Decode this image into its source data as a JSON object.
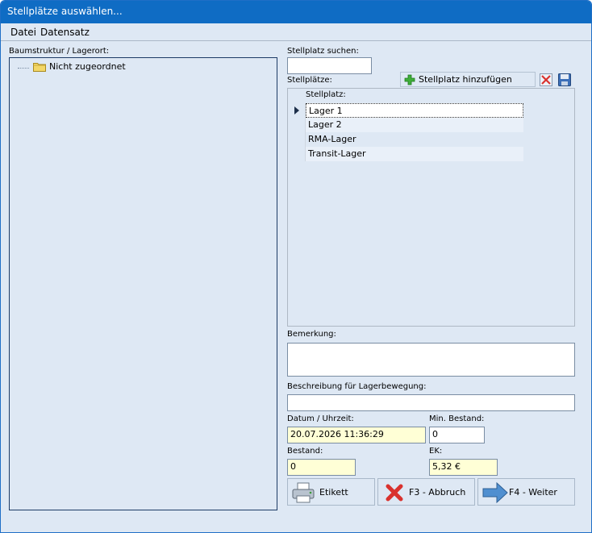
{
  "window": {
    "title": "Stellplätze auswählen..."
  },
  "menu": {
    "items": [
      "Datei",
      "Datensatz"
    ]
  },
  "tree": {
    "label": "Baumstruktur / Lagerort:",
    "nodes": [
      "Nicht zugeordnet"
    ]
  },
  "search": {
    "label": "Stellplatz suchen:",
    "value": ""
  },
  "stellplaetze": {
    "label": "Stellplätze:",
    "add_button": "Stellplatz hinzufügen",
    "column_header": "Stellplatz:",
    "rows": [
      "Lager 1",
      "Lager 2",
      "RMA-Lager",
      "Transit-Lager"
    ],
    "selected_index": 0
  },
  "bemerkung": {
    "label": "Bemerkung:",
    "value": ""
  },
  "beschreibung": {
    "label": "Beschreibung für Lagerbewegung:",
    "value": ""
  },
  "datum": {
    "label": "Datum / Uhrzeit:",
    "value": "20.07.2026 11:36:29"
  },
  "min_bestand": {
    "label": "Min. Bestand:",
    "value": "0"
  },
  "bestand": {
    "label": "Bestand:",
    "value": "0"
  },
  "ek": {
    "label": "EK:",
    "value": "5,32 €"
  },
  "buttons": {
    "etikett": "Etikett",
    "abbruch": "F3 - Abbruch",
    "weiter": "F4 - Weiter"
  },
  "colors": {
    "titlebar": "#0f6cc4",
    "background": "#dee8f4",
    "yellow_field": "#ffffd6",
    "delete_red": "#d9322e",
    "arrow_blue": "#4f8fd0"
  }
}
